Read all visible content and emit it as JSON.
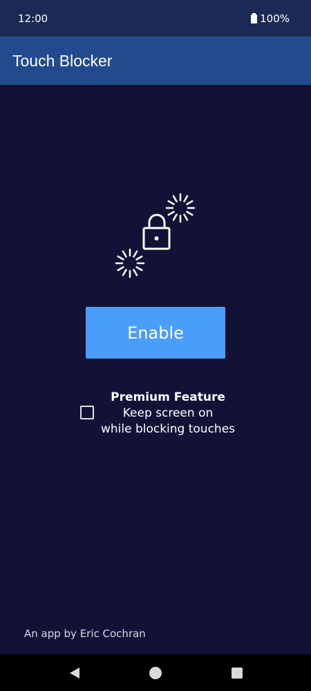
{
  "status_bar": {
    "time": "12:00",
    "battery_text": "100%",
    "battery_icon": "battery-full-icon"
  },
  "app_bar": {
    "title": "Touch Blocker"
  },
  "main": {
    "illustration_icon": "lock-with-sparkles-icon",
    "enable_label": "Enable",
    "premium": {
      "title": "Premium Feature",
      "line1": "Keep screen on",
      "line2": "while blocking touches",
      "checked": false
    },
    "credit": "An app by Eric Cochran"
  },
  "nav_bar": {
    "back_icon": "back-triangle-icon",
    "home_icon": "home-circle-icon",
    "recents_icon": "recents-square-icon"
  },
  "colors": {
    "background": "#121236",
    "status_bar": "#1b2a55",
    "app_bar": "#234a8e",
    "accent_button": "#4a9dfb",
    "nav_bar": "#000000"
  }
}
